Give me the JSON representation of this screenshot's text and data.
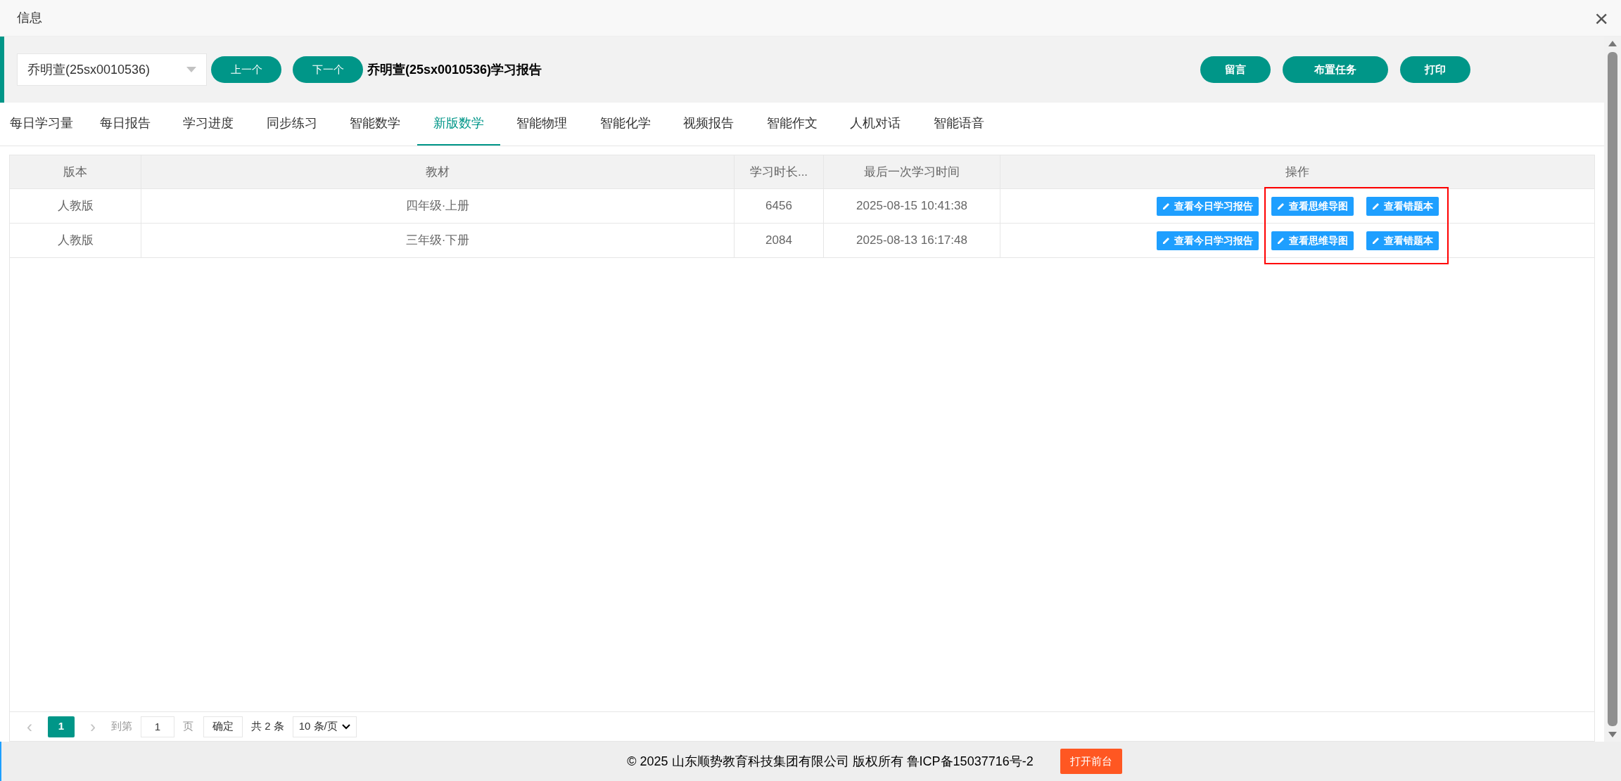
{
  "window": {
    "title": "信息",
    "close": "×"
  },
  "header": {
    "student_select": {
      "value": "乔明萱(25sx0010536)"
    },
    "prev_button": "上一个",
    "next_button": "下一个",
    "report_title": "乔明萱(25sx0010536)学习报告",
    "actions": [
      "留言",
      "布置任务",
      "打印"
    ]
  },
  "tabs": [
    {
      "label": "每日学习量",
      "selected": false
    },
    {
      "label": "每日报告",
      "selected": false
    },
    {
      "label": "学习进度",
      "selected": false
    },
    {
      "label": "同步练习",
      "selected": false
    },
    {
      "label": "智能数学",
      "selected": false
    },
    {
      "label": "新版数学",
      "selected": true
    },
    {
      "label": "智能物理",
      "selected": false
    },
    {
      "label": "智能化学",
      "selected": false
    },
    {
      "label": "视频报告",
      "selected": false
    },
    {
      "label": "智能作文",
      "selected": false
    },
    {
      "label": "人机对话",
      "selected": false
    },
    {
      "label": "智能语音",
      "selected": false
    }
  ],
  "table": {
    "columns": [
      "版本",
      "教材",
      "学习时长...",
      "最后一次学习时间",
      "操作"
    ],
    "rows": [
      {
        "cells": [
          "人教版",
          "四年级·上册",
          "6456",
          "2025-08-15 10:41:38"
        ],
        "actions": [
          {
            "label": "查看今日学习报告",
            "highlighted": false
          },
          {
            "label": "查看思维导图",
            "highlighted": true
          },
          {
            "label": "查看错题本",
            "highlighted": true
          }
        ]
      },
      {
        "cells": [
          "人教版",
          "三年级·下册",
          "2084",
          "2025-08-13 16:17:48"
        ],
        "actions": [
          {
            "label": "查看今日学习报告",
            "highlighted": false
          },
          {
            "label": "查看思维导图",
            "highlighted": true
          },
          {
            "label": "查看错题本",
            "highlighted": true
          }
        ]
      }
    ]
  },
  "pagination": {
    "prev": "‹",
    "current": "1",
    "next": "›",
    "goto_label": "到第",
    "page_input": "1",
    "page_unit": "页",
    "confirm": "确定",
    "total": "共 2 条",
    "page_size": "10 条/页"
  },
  "footer": {
    "copyright": "© 2025 山东顺势教育科技集团有限公司 版权所有 鲁ICP备15037716号-2",
    "open_button": "打开前台"
  }
}
